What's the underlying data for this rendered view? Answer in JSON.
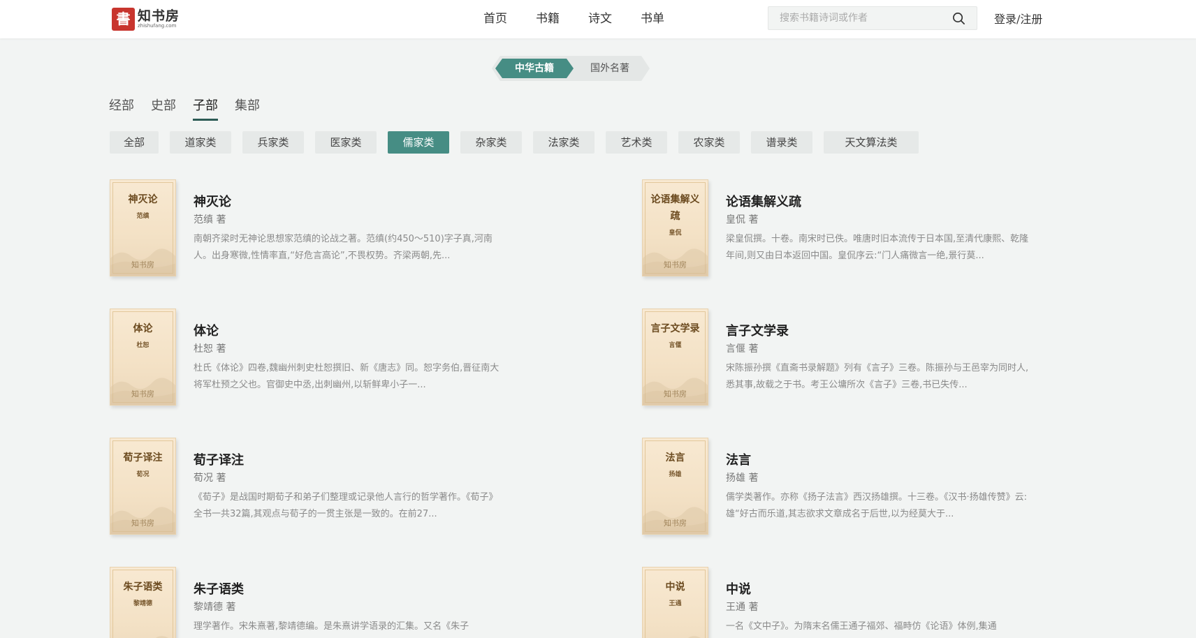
{
  "header": {
    "logo_char": "書",
    "logo_name": "知书房",
    "logo_domain": "zhishufang.com",
    "nav": [
      "首页",
      "书籍",
      "诗文",
      "书单"
    ],
    "search_placeholder": "搜索书籍诗词或作者",
    "login": "登录/注册"
  },
  "switch": {
    "active": "中华古籍",
    "inactive": "国外名著"
  },
  "category_tabs": [
    "经部",
    "史部",
    "子部",
    "集部"
  ],
  "active_category": "子部",
  "chips": [
    "全部",
    "道家类",
    "兵家类",
    "医家类",
    "儒家类",
    "杂家类",
    "法家类",
    "艺术类",
    "农家类",
    "谱录类",
    "天文算法类"
  ],
  "active_chip": "儒家类",
  "cover_brand": "知书房",
  "books": [
    {
      "title": "神灭论",
      "author": "范缜 著",
      "cover_author": "范缜",
      "desc": "南朝齐梁时无神论思想家范缜的论战之著。范缜(约450～510)字子真,河南人。出身寒微,性情率直,“好危言高论”,不畏权势。齐梁两朝,先..."
    },
    {
      "title": "论语集解义疏",
      "author": "皇侃 著",
      "cover_author": "皇侃",
      "desc": "梁皇侃撰。十卷。南宋时已佚。唯唐时旧本流传于日本国,至清代康熙、乾隆年间,则又由日本返回中国。皇侃序云:“门人痛微言一绝,景行莫..."
    },
    {
      "title": "体论",
      "author": "杜恕 著",
      "cover_author": "杜恕",
      "desc": "杜氏《体论》四卷,魏幽州刺史杜恕撰旧、新《唐志》同。恕字务伯,晋征南大将军杜预之父也。官御史中丞,出刺幽州,以斩鲜卑小子一..."
    },
    {
      "title": "言子文学录",
      "author": "言偃 著",
      "cover_author": "言偃",
      "desc": "宋陈振孙撰《直斋书录解题》列有《言子》三卷。陈振孙与王邑宰为同时人,悉其事,故载之于书。考王公墉所次《言子》三卷,书已失传..."
    },
    {
      "title": "荀子译注",
      "author": "荀况 著",
      "cover_author": "荀况",
      "desc": "《荀子》是战国时期荀子和弟子们整理或记录他人言行的哲学著作。《荀子》全书一共32篇,其观点与荀子的一贯主张是一致的。在前27..."
    },
    {
      "title": "法言",
      "author": "扬雄 著",
      "cover_author": "扬雄",
      "desc": "儒学类著作。亦称《扬子法言》西汉扬雄撰。十三卷。《汉书·扬雄传赞》云:雄“好古而乐道,其志欲求文章成名于后世,以为经莫大于..."
    },
    {
      "title": "朱子语类",
      "author": "黎靖德 著",
      "cover_author": "黎靖德",
      "desc": "理学著作。宋朱熹著,黎靖德编。是朱熹讲学语录的汇集。又名《朱子"
    },
    {
      "title": "中说",
      "author": "王通 著",
      "cover_author": "王通",
      "desc": "一名《文中子》。为隋末名儒王通子福郊、福畤仿《论语》体例,集通"
    }
  ]
}
